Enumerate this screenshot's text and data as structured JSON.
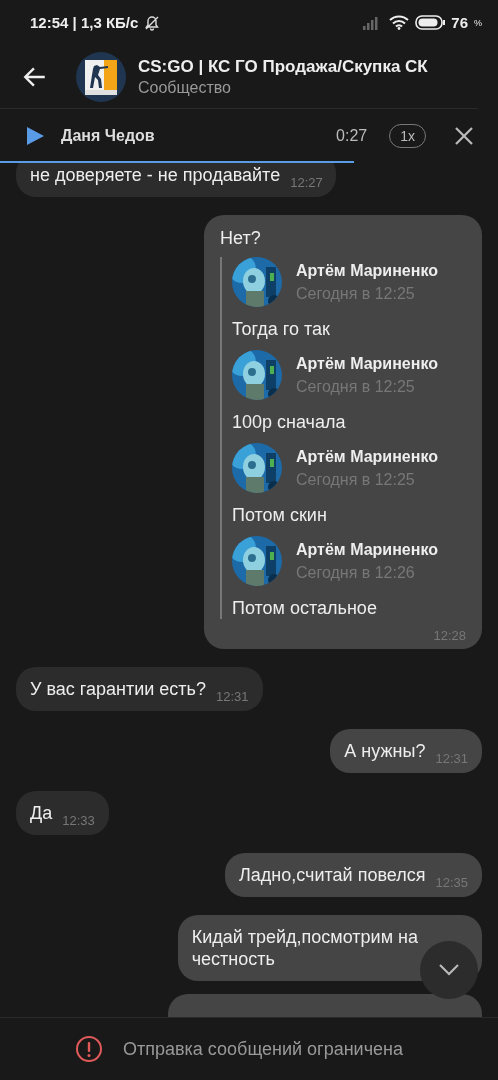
{
  "status_bar": {
    "time": "12:54 | 1,3 КБ/с",
    "battery": "76",
    "battery_unit": "%"
  },
  "header": {
    "title": "CS:GO | КС ГО Продажа/Скупка СК",
    "subtitle": "Сообщество"
  },
  "player": {
    "author": "Даня Чедов",
    "duration": "0:27",
    "speed": "1x"
  },
  "messages": [
    {
      "kind": "text",
      "outgoing": false,
      "text": "не доверяете - не продавайте",
      "time": "12:27"
    },
    {
      "kind": "forward",
      "outgoing": true,
      "text": "Нет?",
      "time": "12:28",
      "items": [
        {
          "author": "Артём Мариненко",
          "date": "Сегодня в 12:25",
          "text": "Тогда го так"
        },
        {
          "author": "Артём Мариненко",
          "date": "Сегодня в 12:25",
          "text": "100р сначала"
        },
        {
          "author": "Артём Мариненко",
          "date": "Сегодня в 12:25",
          "text": "Потом скин"
        },
        {
          "author": "Артём Мариненко",
          "date": "Сегодня в 12:26",
          "text": "Потом остальное"
        }
      ]
    },
    {
      "kind": "text",
      "outgoing": false,
      "text": "У вас гарантии есть?",
      "time": "12:31"
    },
    {
      "kind": "text",
      "outgoing": true,
      "text": "А нужны?",
      "time": "12:31"
    },
    {
      "kind": "text",
      "outgoing": false,
      "text": "Да",
      "time": "12:33"
    },
    {
      "kind": "text",
      "outgoing": true,
      "text": "Ладно,считай повелся",
      "time": "12:35"
    },
    {
      "kind": "text",
      "outgoing": true,
      "text": "Кидай трейд,посмотрим на\nчестность"
    },
    {
      "kind": "cut_off",
      "outgoing": true
    }
  ],
  "notice": "Отправка сообщений ограничена"
}
